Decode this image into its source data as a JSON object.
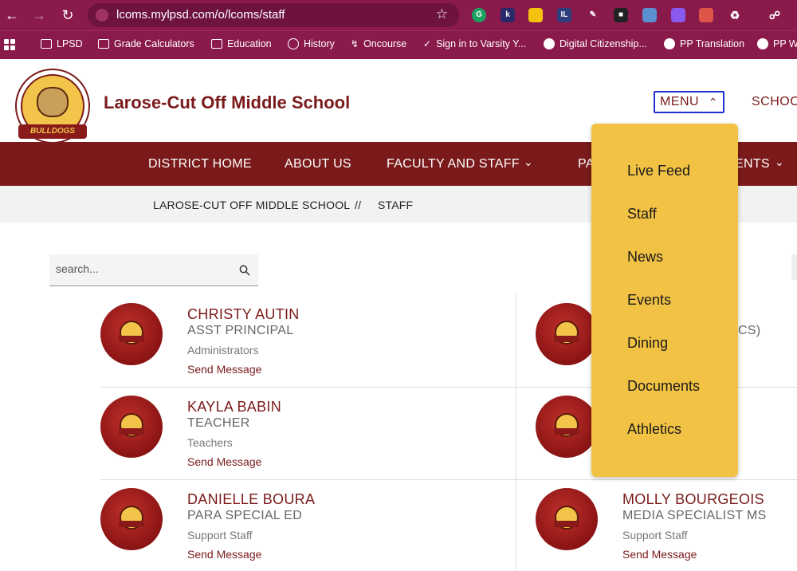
{
  "browser": {
    "url": "lcoms.mylpsd.com/o/lcoms/staff",
    "bookmarks": [
      "LPSD",
      "Grade Calculators",
      "Education",
      "History",
      "Oncourse",
      "Sign in to Varsity Y...",
      "Digital Citizenship...",
      "PP Translation",
      "PP W"
    ]
  },
  "header": {
    "school_name": "Larose-Cut Off Middle School",
    "logo_text": "BULLDOGS",
    "menu_label": "MENU",
    "schools_label": "SCHOO"
  },
  "nav": {
    "items": [
      "DISTRICT HOME",
      "ABOUT US",
      "FACULTY AND STAFF",
      "PA",
      "ENTS"
    ]
  },
  "breadcrumb": {
    "school": "LAROSE-CUT OFF MIDDLE SCHOOL",
    "separator": "//",
    "page": "STAFF"
  },
  "search": {
    "placeholder": "search..."
  },
  "staff": [
    {
      "name": "CHRISTY AUTIN",
      "title": "ASST PRINCIPAL",
      "dept": "Administrators",
      "action": "Send Message"
    },
    {
      "name": "KAYLA BABIN",
      "title": "TEACHER",
      "dept": "Teachers",
      "action": "Send Message"
    },
    {
      "name": "DANIELLE BOURA",
      "title": "PARA SPECIAL ED",
      "dept": "Support Staff",
      "action": "Send Message"
    },
    {
      "name": "MOLLY BOURGEOIS",
      "title": "MEDIA SPECIALIST MS",
      "dept": "Support Staff",
      "action": "Send Message"
    }
  ],
  "partial_text": "CS)",
  "menu": {
    "items": [
      "Live Feed",
      "Staff",
      "News",
      "Events",
      "Dining",
      "Documents",
      "Athletics"
    ]
  },
  "colors": {
    "browser": "#8a1a4c",
    "brand": "#7a1a1a",
    "dropdown": "#f2c244"
  }
}
